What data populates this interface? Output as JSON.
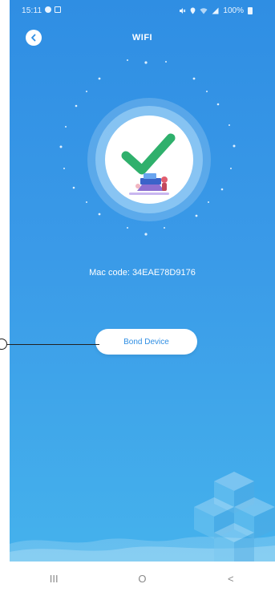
{
  "status_bar": {
    "time": "15:11",
    "battery": "100%",
    "icons_left": [
      "sync-icon",
      "image-icon"
    ],
    "icons_right": [
      "mute-icon",
      "location-icon",
      "wifi-icon",
      "signal-icon",
      "battery-icon"
    ]
  },
  "header": {
    "title": "WIFI",
    "back_icon": "chevron-left-icon"
  },
  "hero": {
    "icon": "checkmark-icon",
    "check_color": "#2fb06c"
  },
  "device": {
    "mac_code": "Mac code: 34EAE78D9176"
  },
  "actions": {
    "bond_label": "Bond Device"
  },
  "nav": {
    "recents": "III",
    "home": "O",
    "back": "<"
  },
  "colors": {
    "gradient_top": "#2f8ee3",
    "gradient_bottom": "#45b2ec",
    "button_text": "#2f8ee3"
  }
}
